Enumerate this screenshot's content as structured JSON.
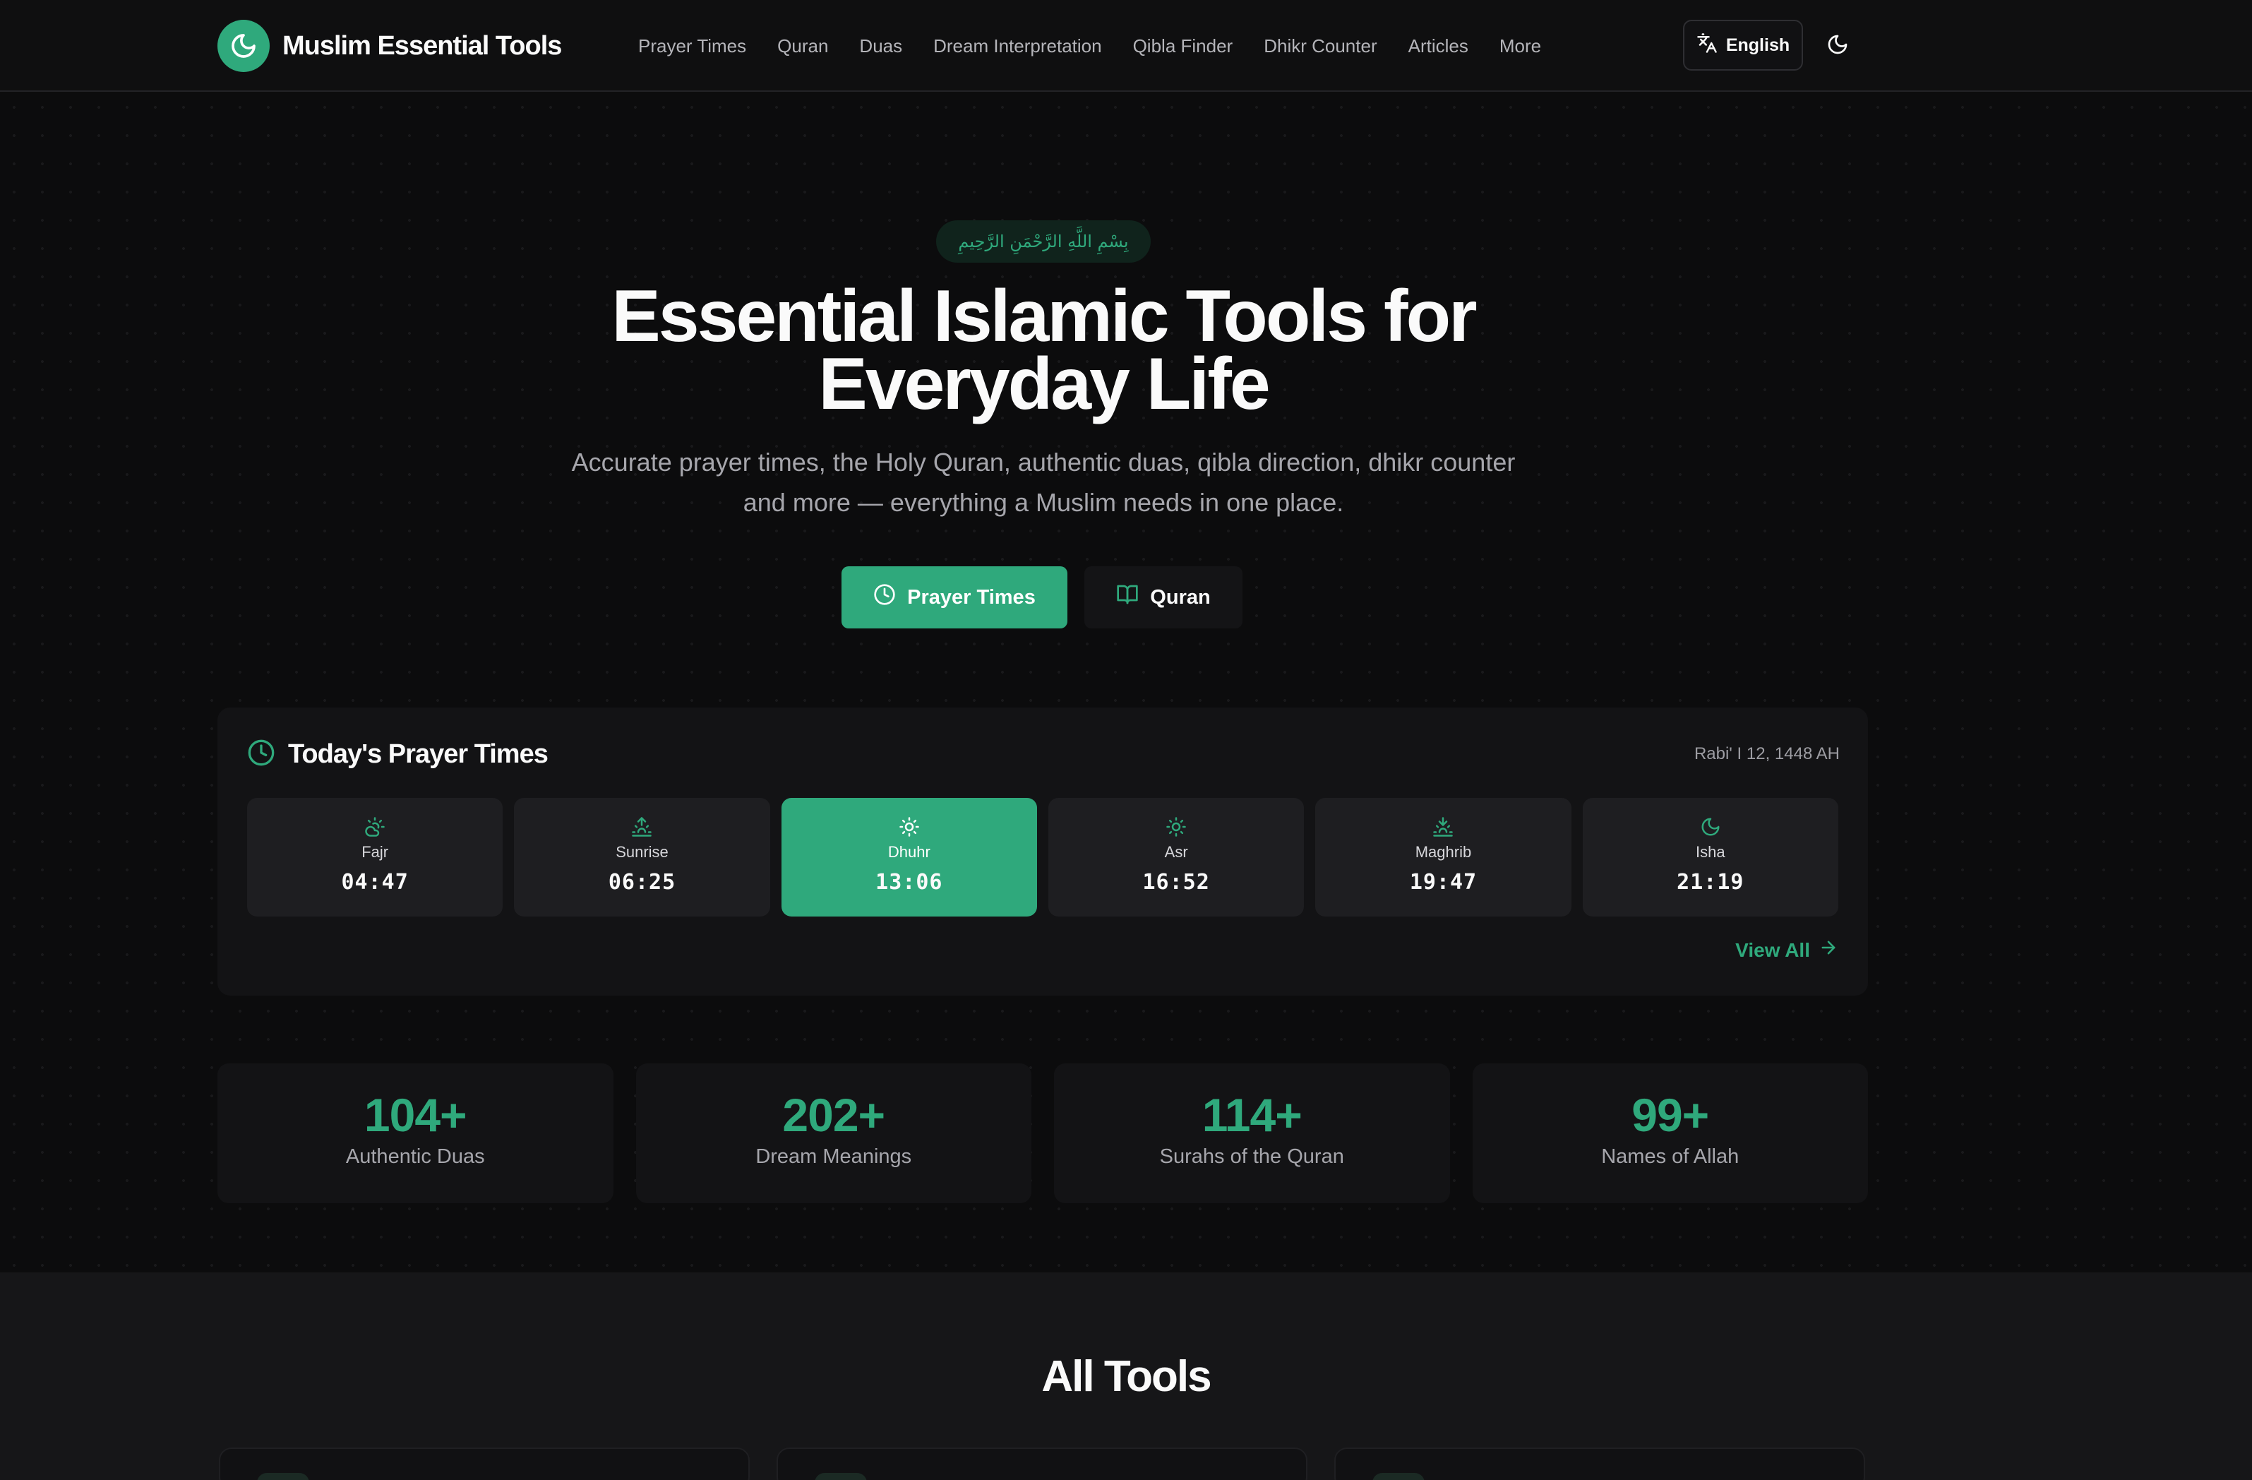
{
  "brand": {
    "name": "Muslim Essential Tools",
    "logo_icon": "crescent-moon-icon"
  },
  "nav": {
    "links": [
      "Prayer Times",
      "Quran",
      "Duas",
      "Dream Interpretation",
      "Qibla Finder",
      "Dhikr Counter",
      "Articles",
      "More"
    ],
    "language": "English",
    "theme_icon": "moon-icon"
  },
  "hero": {
    "bismillah": "بِسْمِ اللَّهِ الرَّحْمَنِ الرَّحِيمِ",
    "title_line1": "Essential Islamic Tools for",
    "title_line2": "Everyday Life",
    "subtitle": "Accurate prayer times, the Holy Quran, authentic duas, qibla direction, dhikr counter and more — everything a Muslim needs in one place.",
    "primary_button": "Prayer Times",
    "secondary_button": "Quran"
  },
  "prayer_times": {
    "title": "Today's Prayer Times",
    "hijri_date": "Rabi' I 12, 1448 AH",
    "view_all": "View All",
    "prayers": [
      {
        "name": "Fajr",
        "time": "04:47",
        "icon": "cloud-sun-icon",
        "active": false
      },
      {
        "name": "Sunrise",
        "time": "06:25",
        "icon": "sunrise-icon",
        "active": false
      },
      {
        "name": "Dhuhr",
        "time": "13:06",
        "icon": "sun-icon",
        "active": true
      },
      {
        "name": "Asr",
        "time": "16:52",
        "icon": "sun-icon",
        "active": false
      },
      {
        "name": "Maghrib",
        "time": "19:47",
        "icon": "sunset-icon",
        "active": false
      },
      {
        "name": "Isha",
        "time": "21:19",
        "icon": "moon-icon",
        "active": false
      }
    ]
  },
  "stats": [
    {
      "value": "104+",
      "label": "Authentic Duas"
    },
    {
      "value": "202+",
      "label": "Dream Meanings"
    },
    {
      "value": "114+",
      "label": "Surahs of the Quran"
    },
    {
      "value": "99+",
      "label": "Names of Allah"
    }
  ],
  "tools": {
    "title": "All Tools"
  },
  "colors": {
    "accent": "#2fa97c",
    "background": "#0c0c0d",
    "card": "#131315",
    "tile": "#1e1e21"
  }
}
